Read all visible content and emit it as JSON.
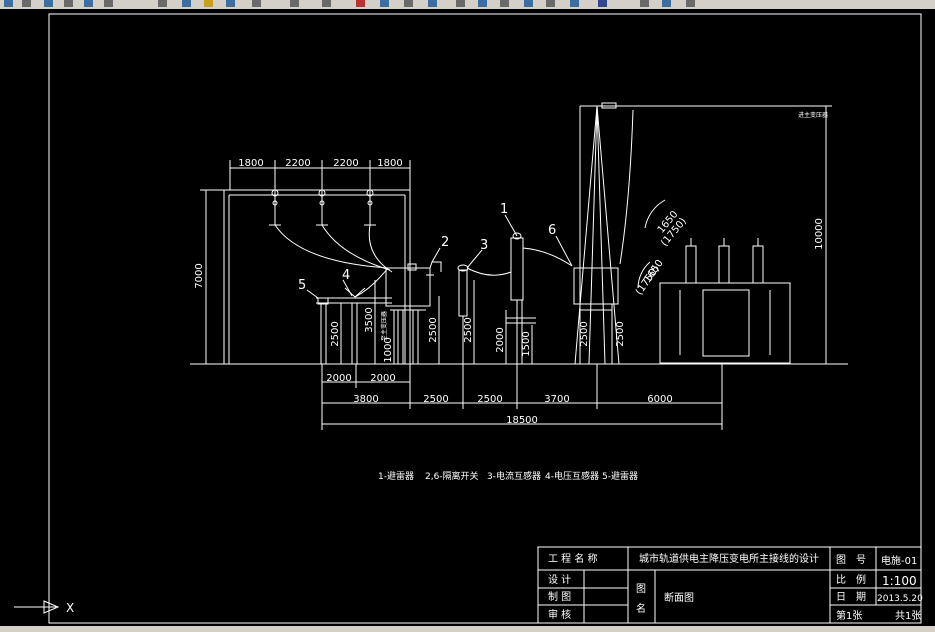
{
  "dimensions": {
    "top": [
      "1800",
      "2200",
      "2200",
      "1800"
    ],
    "left_height": "7000",
    "right_height": "10000",
    "v2500_a": "2500",
    "v2500_b": "2500",
    "v3500": "3500",
    "v1000": "1000",
    "v2500_c": "2500",
    "v2500_d": "2500",
    "v2000": "2000",
    "v1500": "1500",
    "v2500_e": "2500",
    "h2000_a": "2000",
    "h2000_b": "2000",
    "row2": [
      "3800",
      "2500",
      "2500",
      "3700",
      "6000"
    ],
    "total": "18500",
    "clear_1650_a": "1650",
    "clear_1750_a": "(1750)",
    "clear_1650_b": "1650",
    "clear_1750_b": "(1750)"
  },
  "callouts": {
    "n1": "1",
    "n2": "2",
    "n3": "3",
    "n4": "4",
    "n5": "5",
    "n6": "6"
  },
  "legend": {
    "item1": "1-避雷器",
    "item2": "2,6-隔离开关",
    "item3": "3-电流互感器",
    "item4": "4-电压互感器",
    "item5": "5-避雷器"
  },
  "notes": {
    "top_right": "进主变压器",
    "vertical": "至主变压器"
  },
  "title_block": {
    "project_label": "工 程 名 称",
    "project_name": "城市轨道供电主降压变电所主接线的设计",
    "design_label": "设 计",
    "drawing_label": "制 图",
    "review_label": "审 核",
    "tu_label": "图",
    "ming_label": "名",
    "drawing_name": "断面图",
    "number_label": "图　号",
    "number_value": "电施-01",
    "scale_label": "比　例",
    "scale_value": "1:100",
    "date_label": "日　期",
    "date_value": "2013.5.20",
    "sheet_label": "第1张",
    "total_label": "共1张"
  },
  "ucs": {
    "x_label": "X"
  },
  "colors": {
    "line": "#ffffff",
    "background": "#000000",
    "toolbar": "#d4d0c8"
  }
}
